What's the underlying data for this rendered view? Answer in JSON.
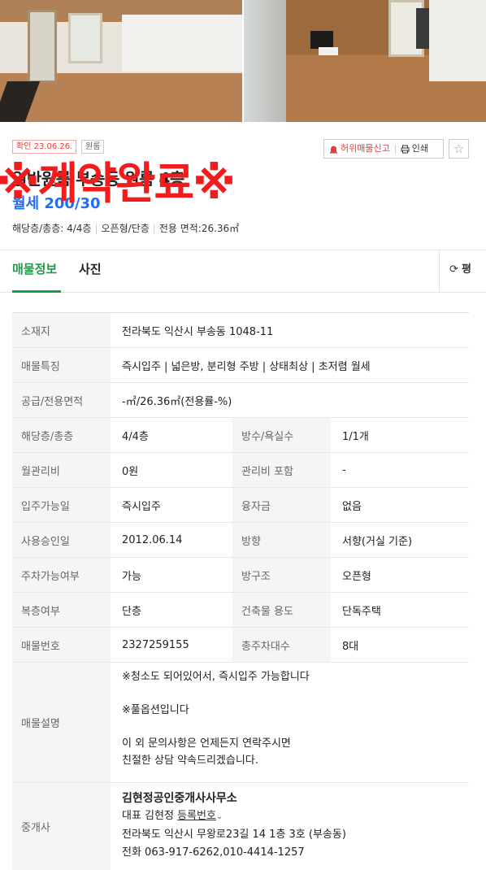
{
  "badges": {
    "confirm": "확인 23.06.26.",
    "type": "원룸"
  },
  "actions": {
    "report_label": "허위매물신고",
    "print_label": "인쇄"
  },
  "listing": {
    "title": "일반원룸 부송동 원룸 4층",
    "price": "월세 200/30",
    "stamp": "※계약완료※",
    "specs": [
      "해당층/총층: 4/4층",
      "오픈형/단층",
      "전용 면적:26.36㎡"
    ]
  },
  "tabs": {
    "info": "매물정보",
    "photos": "사진",
    "right": "평"
  },
  "detail": {
    "address_label": "소재지",
    "address": "전라북도 익산시 부송동 1048-11",
    "features_label": "매물특징",
    "features": "즉시입주 | 넓은방, 분리형 주방 | 상태최상 | 초저렴 월세",
    "area_label": "공급/전용면적",
    "area": "-㎡/26.36㎡(전용률-%)",
    "floor_label": "해당층/총층",
    "floor": "4/4층",
    "rooms_label": "방수/욕실수",
    "rooms": "1/1개",
    "mgmt_label": "월관리비",
    "mgmt": "0원",
    "mgmt_incl_label": "관리비 포함",
    "mgmt_incl": "-",
    "movein_label": "입주가능일",
    "movein": "즉시입주",
    "loan_label": "융자금",
    "loan": "없음",
    "approval_label": "사용승인일",
    "approval": "2012.06.14",
    "direction_label": "방향",
    "direction": "서향(거실 기준)",
    "parking_label": "주차가능여부",
    "parking": "가능",
    "structure_label": "방구조",
    "structure": "오픈형",
    "duplex_label": "복층여부",
    "duplex": "단층",
    "usage_label": "건축물 용도",
    "usage": "단독주택",
    "number_label": "매물번호",
    "number": "2327259155",
    "total_parking_label": "총주차대수",
    "total_parking": "8대",
    "desc_label": "매물설명",
    "desc_lines": [
      "※청소도 되어있어서, 즉시입주 가능합니다",
      "",
      "※풀옵션입니다",
      "",
      "이 외 문의사항은 언제든지 연락주시면",
      "친절한 상담 약속드리겠습니다."
    ],
    "agent_label": "중개사",
    "agent": {
      "name": "김현정공인중개사사무소",
      "rep": "대표 김현정",
      "reg_link": "등록번호",
      "address": "전라북도 익산시 무왕로23길 14 1층 3호 (부송동)",
      "phone": "전화 063-917-6262,010-4414-1257"
    }
  }
}
